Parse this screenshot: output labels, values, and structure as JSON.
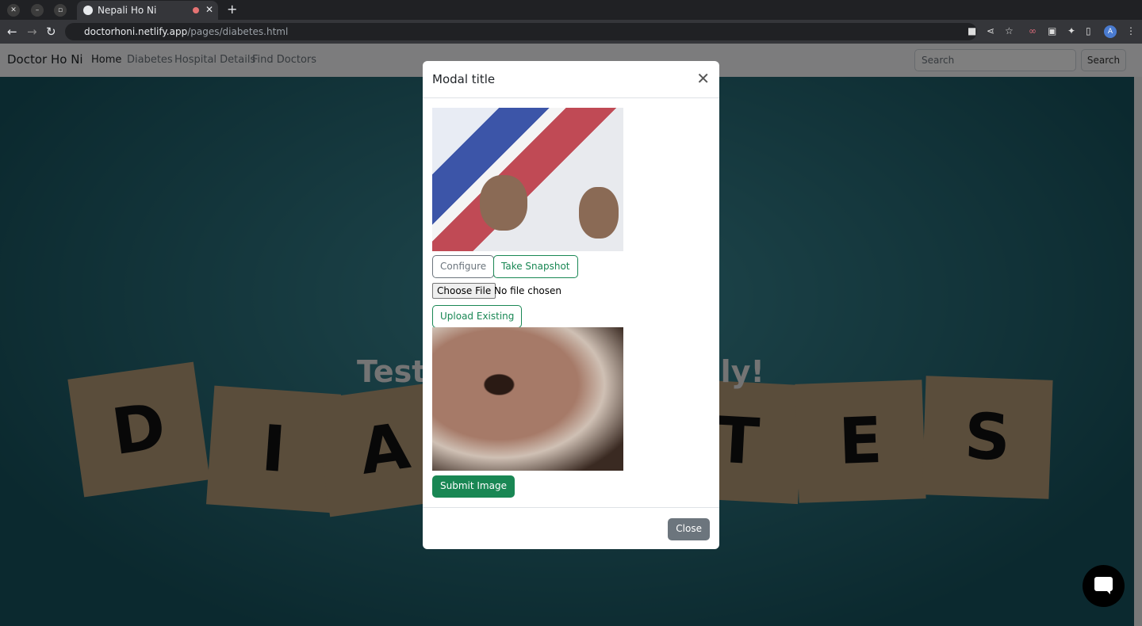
{
  "browser": {
    "tab_title": "Nepali Ho Ni",
    "url_host": "doctorhoni.netlify.app",
    "url_path": "/pages/diabetes.html",
    "profile_initial": "A"
  },
  "navbar": {
    "brand": "Doctor Ho Ni",
    "links": [
      "Home",
      "Diabetes",
      "Hospital Details",
      "Find Doctors"
    ],
    "active": "Home",
    "search_placeholder": "Search",
    "search_button": "Search"
  },
  "hero": {
    "text_left": "Test",
    "text_right": "ally!",
    "blocks": [
      "D",
      "I",
      "A",
      "T",
      "E",
      "S"
    ]
  },
  "modal": {
    "title": "Modal title",
    "configure": "Configure",
    "take_snapshot": "Take Snapshot",
    "choose_file": "Choose File",
    "no_file": "No file chosen",
    "upload_existing": "Upload Existing",
    "submit": "Submit Image",
    "close": "Close"
  },
  "colors": {
    "success": "#198754",
    "secondary": "#6c757d"
  }
}
